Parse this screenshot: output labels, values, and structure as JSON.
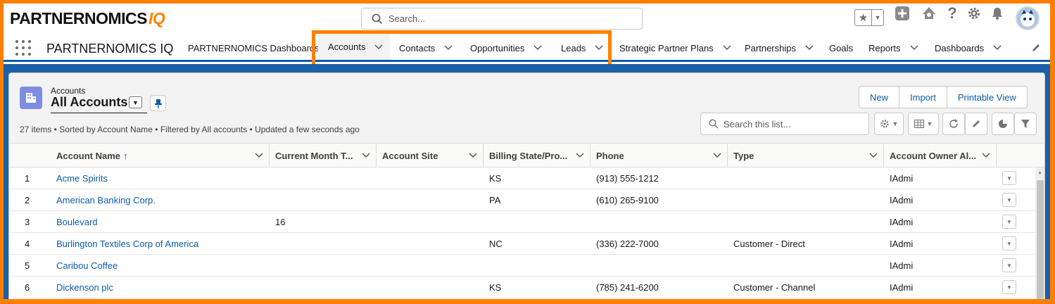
{
  "header": {
    "logo_main": "PARTNERNOMICS",
    "logo_accent": "IQ",
    "search_placeholder": "Search..."
  },
  "nav": {
    "app_name": "PARTNERNOMICS IQ",
    "items": [
      {
        "label": "PARTNERNOMICS Dashboards",
        "has_menu": false,
        "active": false
      },
      {
        "label": "Accounts",
        "has_menu": true,
        "active": true
      },
      {
        "label": "Contacts",
        "has_menu": true,
        "active": false
      },
      {
        "label": "Opportunities",
        "has_menu": true,
        "active": false
      },
      {
        "label": "Leads",
        "has_menu": true,
        "active": false
      },
      {
        "label": "Strategic Partner Plans",
        "has_menu": true,
        "active": false
      },
      {
        "label": "Partnerships",
        "has_menu": true,
        "active": false
      },
      {
        "label": "Goals",
        "has_menu": false,
        "active": false
      },
      {
        "label": "Reports",
        "has_menu": true,
        "active": false
      },
      {
        "label": "Dashboards",
        "has_menu": true,
        "active": false
      }
    ]
  },
  "list": {
    "object_label": "Accounts",
    "view_name": "All Accounts",
    "meta": "27 items • Sorted by Account Name • Filtered by All accounts • Updated a few seconds ago",
    "buttons": {
      "new": "New",
      "import": "Import",
      "printable": "Printable View"
    },
    "search_placeholder": "Search this list..."
  },
  "table": {
    "columns": [
      "Account Name",
      "Current Month T...",
      "Account Site",
      "Billing State/Pro...",
      "Phone",
      "Type",
      "Account Owner Al..."
    ],
    "rows": [
      {
        "num": "1",
        "name": "Acme Spirits",
        "current": "",
        "site": "",
        "state": "KS",
        "phone": "(913) 555-1212",
        "type": "",
        "owner": "IAdmi"
      },
      {
        "num": "2",
        "name": "American Banking Corp.",
        "current": "",
        "site": "",
        "state": "PA",
        "phone": "(610) 265-9100",
        "type": "",
        "owner": "IAdmi"
      },
      {
        "num": "3",
        "name": "Boulevard",
        "current": "16",
        "site": "",
        "state": "",
        "phone": "",
        "type": "",
        "owner": "IAdmi"
      },
      {
        "num": "4",
        "name": "Burlington Textiles Corp of America",
        "current": "",
        "site": "",
        "state": "NC",
        "phone": "(336) 222-7000",
        "type": "Customer - Direct",
        "owner": "IAdmi"
      },
      {
        "num": "5",
        "name": "Caribou Coffee",
        "current": "",
        "site": "",
        "state": "",
        "phone": "",
        "type": "",
        "owner": "IAdmi"
      },
      {
        "num": "6",
        "name": "Dickenson plc",
        "current": "",
        "site": "",
        "state": "KS",
        "phone": "(785) 241-6200",
        "type": "Customer - Channel",
        "owner": "IAdmi"
      }
    ]
  },
  "colors": {
    "brand_orange": "#ff8000",
    "link_blue": "#0b5cab",
    "accounts_icon": "#7f8de1"
  }
}
